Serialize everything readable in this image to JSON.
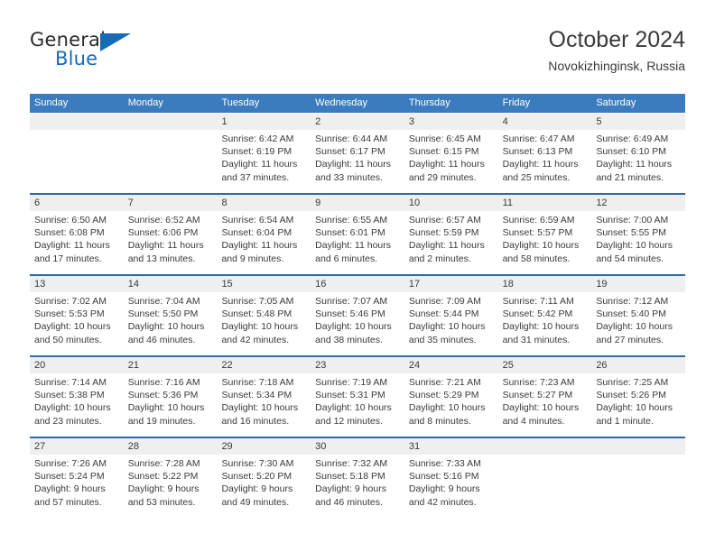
{
  "brand": {
    "name_top": "General",
    "name_bottom": "Blue",
    "accent_color": "#176bb5",
    "triangle_icon": "triangle-icon"
  },
  "header": {
    "title": "October 2024",
    "subtitle": "Novokizhinginsk, Russia"
  },
  "calendar": {
    "header_color": "#3b7cbf",
    "row_border_color": "#2f6aa8",
    "date_band_color": "#efefef",
    "weekdays": [
      "Sunday",
      "Monday",
      "Tuesday",
      "Wednesday",
      "Thursday",
      "Friday",
      "Saturday"
    ],
    "weeks": [
      [
        {
          "day": "",
          "empty": true,
          "sunrise": "",
          "sunset": "",
          "daylight_1": "",
          "daylight_2": ""
        },
        {
          "day": "",
          "empty": true,
          "sunrise": "",
          "sunset": "",
          "daylight_1": "",
          "daylight_2": ""
        },
        {
          "day": "1",
          "empty": false,
          "sunrise": "Sunrise: 6:42 AM",
          "sunset": "Sunset: 6:19 PM",
          "daylight_1": "Daylight: 11 hours",
          "daylight_2": "and 37 minutes."
        },
        {
          "day": "2",
          "empty": false,
          "sunrise": "Sunrise: 6:44 AM",
          "sunset": "Sunset: 6:17 PM",
          "daylight_1": "Daylight: 11 hours",
          "daylight_2": "and 33 minutes."
        },
        {
          "day": "3",
          "empty": false,
          "sunrise": "Sunrise: 6:45 AM",
          "sunset": "Sunset: 6:15 PM",
          "daylight_1": "Daylight: 11 hours",
          "daylight_2": "and 29 minutes."
        },
        {
          "day": "4",
          "empty": false,
          "sunrise": "Sunrise: 6:47 AM",
          "sunset": "Sunset: 6:13 PM",
          "daylight_1": "Daylight: 11 hours",
          "daylight_2": "and 25 minutes."
        },
        {
          "day": "5",
          "empty": false,
          "sunrise": "Sunrise: 6:49 AM",
          "sunset": "Sunset: 6:10 PM",
          "daylight_1": "Daylight: 11 hours",
          "daylight_2": "and 21 minutes."
        }
      ],
      [
        {
          "day": "6",
          "empty": false,
          "sunrise": "Sunrise: 6:50 AM",
          "sunset": "Sunset: 6:08 PM",
          "daylight_1": "Daylight: 11 hours",
          "daylight_2": "and 17 minutes."
        },
        {
          "day": "7",
          "empty": false,
          "sunrise": "Sunrise: 6:52 AM",
          "sunset": "Sunset: 6:06 PM",
          "daylight_1": "Daylight: 11 hours",
          "daylight_2": "and 13 minutes."
        },
        {
          "day": "8",
          "empty": false,
          "sunrise": "Sunrise: 6:54 AM",
          "sunset": "Sunset: 6:04 PM",
          "daylight_1": "Daylight: 11 hours",
          "daylight_2": "and 9 minutes."
        },
        {
          "day": "9",
          "empty": false,
          "sunrise": "Sunrise: 6:55 AM",
          "sunset": "Sunset: 6:01 PM",
          "daylight_1": "Daylight: 11 hours",
          "daylight_2": "and 6 minutes."
        },
        {
          "day": "10",
          "empty": false,
          "sunrise": "Sunrise: 6:57 AM",
          "sunset": "Sunset: 5:59 PM",
          "daylight_1": "Daylight: 11 hours",
          "daylight_2": "and 2 minutes."
        },
        {
          "day": "11",
          "empty": false,
          "sunrise": "Sunrise: 6:59 AM",
          "sunset": "Sunset: 5:57 PM",
          "daylight_1": "Daylight: 10 hours",
          "daylight_2": "and 58 minutes."
        },
        {
          "day": "12",
          "empty": false,
          "sunrise": "Sunrise: 7:00 AM",
          "sunset": "Sunset: 5:55 PM",
          "daylight_1": "Daylight: 10 hours",
          "daylight_2": "and 54 minutes."
        }
      ],
      [
        {
          "day": "13",
          "empty": false,
          "sunrise": "Sunrise: 7:02 AM",
          "sunset": "Sunset: 5:53 PM",
          "daylight_1": "Daylight: 10 hours",
          "daylight_2": "and 50 minutes."
        },
        {
          "day": "14",
          "empty": false,
          "sunrise": "Sunrise: 7:04 AM",
          "sunset": "Sunset: 5:50 PM",
          "daylight_1": "Daylight: 10 hours",
          "daylight_2": "and 46 minutes."
        },
        {
          "day": "15",
          "empty": false,
          "sunrise": "Sunrise: 7:05 AM",
          "sunset": "Sunset: 5:48 PM",
          "daylight_1": "Daylight: 10 hours",
          "daylight_2": "and 42 minutes."
        },
        {
          "day": "16",
          "empty": false,
          "sunrise": "Sunrise: 7:07 AM",
          "sunset": "Sunset: 5:46 PM",
          "daylight_1": "Daylight: 10 hours",
          "daylight_2": "and 38 minutes."
        },
        {
          "day": "17",
          "empty": false,
          "sunrise": "Sunrise: 7:09 AM",
          "sunset": "Sunset: 5:44 PM",
          "daylight_1": "Daylight: 10 hours",
          "daylight_2": "and 35 minutes."
        },
        {
          "day": "18",
          "empty": false,
          "sunrise": "Sunrise: 7:11 AM",
          "sunset": "Sunset: 5:42 PM",
          "daylight_1": "Daylight: 10 hours",
          "daylight_2": "and 31 minutes."
        },
        {
          "day": "19",
          "empty": false,
          "sunrise": "Sunrise: 7:12 AM",
          "sunset": "Sunset: 5:40 PM",
          "daylight_1": "Daylight: 10 hours",
          "daylight_2": "and 27 minutes."
        }
      ],
      [
        {
          "day": "20",
          "empty": false,
          "sunrise": "Sunrise: 7:14 AM",
          "sunset": "Sunset: 5:38 PM",
          "daylight_1": "Daylight: 10 hours",
          "daylight_2": "and 23 minutes."
        },
        {
          "day": "21",
          "empty": false,
          "sunrise": "Sunrise: 7:16 AM",
          "sunset": "Sunset: 5:36 PM",
          "daylight_1": "Daylight: 10 hours",
          "daylight_2": "and 19 minutes."
        },
        {
          "day": "22",
          "empty": false,
          "sunrise": "Sunrise: 7:18 AM",
          "sunset": "Sunset: 5:34 PM",
          "daylight_1": "Daylight: 10 hours",
          "daylight_2": "and 16 minutes."
        },
        {
          "day": "23",
          "empty": false,
          "sunrise": "Sunrise: 7:19 AM",
          "sunset": "Sunset: 5:31 PM",
          "daylight_1": "Daylight: 10 hours",
          "daylight_2": "and 12 minutes."
        },
        {
          "day": "24",
          "empty": false,
          "sunrise": "Sunrise: 7:21 AM",
          "sunset": "Sunset: 5:29 PM",
          "daylight_1": "Daylight: 10 hours",
          "daylight_2": "and 8 minutes."
        },
        {
          "day": "25",
          "empty": false,
          "sunrise": "Sunrise: 7:23 AM",
          "sunset": "Sunset: 5:27 PM",
          "daylight_1": "Daylight: 10 hours",
          "daylight_2": "and 4 minutes."
        },
        {
          "day": "26",
          "empty": false,
          "sunrise": "Sunrise: 7:25 AM",
          "sunset": "Sunset: 5:26 PM",
          "daylight_1": "Daylight: 10 hours",
          "daylight_2": "and 1 minute."
        }
      ],
      [
        {
          "day": "27",
          "empty": false,
          "sunrise": "Sunrise: 7:26 AM",
          "sunset": "Sunset: 5:24 PM",
          "daylight_1": "Daylight: 9 hours",
          "daylight_2": "and 57 minutes."
        },
        {
          "day": "28",
          "empty": false,
          "sunrise": "Sunrise: 7:28 AM",
          "sunset": "Sunset: 5:22 PM",
          "daylight_1": "Daylight: 9 hours",
          "daylight_2": "and 53 minutes."
        },
        {
          "day": "29",
          "empty": false,
          "sunrise": "Sunrise: 7:30 AM",
          "sunset": "Sunset: 5:20 PM",
          "daylight_1": "Daylight: 9 hours",
          "daylight_2": "and 49 minutes."
        },
        {
          "day": "30",
          "empty": false,
          "sunrise": "Sunrise: 7:32 AM",
          "sunset": "Sunset: 5:18 PM",
          "daylight_1": "Daylight: 9 hours",
          "daylight_2": "and 46 minutes."
        },
        {
          "day": "31",
          "empty": false,
          "sunrise": "Sunrise: 7:33 AM",
          "sunset": "Sunset: 5:16 PM",
          "daylight_1": "Daylight: 9 hours",
          "daylight_2": "and 42 minutes."
        },
        {
          "day": "",
          "empty": true,
          "sunrise": "",
          "sunset": "",
          "daylight_1": "",
          "daylight_2": ""
        },
        {
          "day": "",
          "empty": true,
          "sunrise": "",
          "sunset": "",
          "daylight_1": "",
          "daylight_2": ""
        }
      ]
    ]
  }
}
